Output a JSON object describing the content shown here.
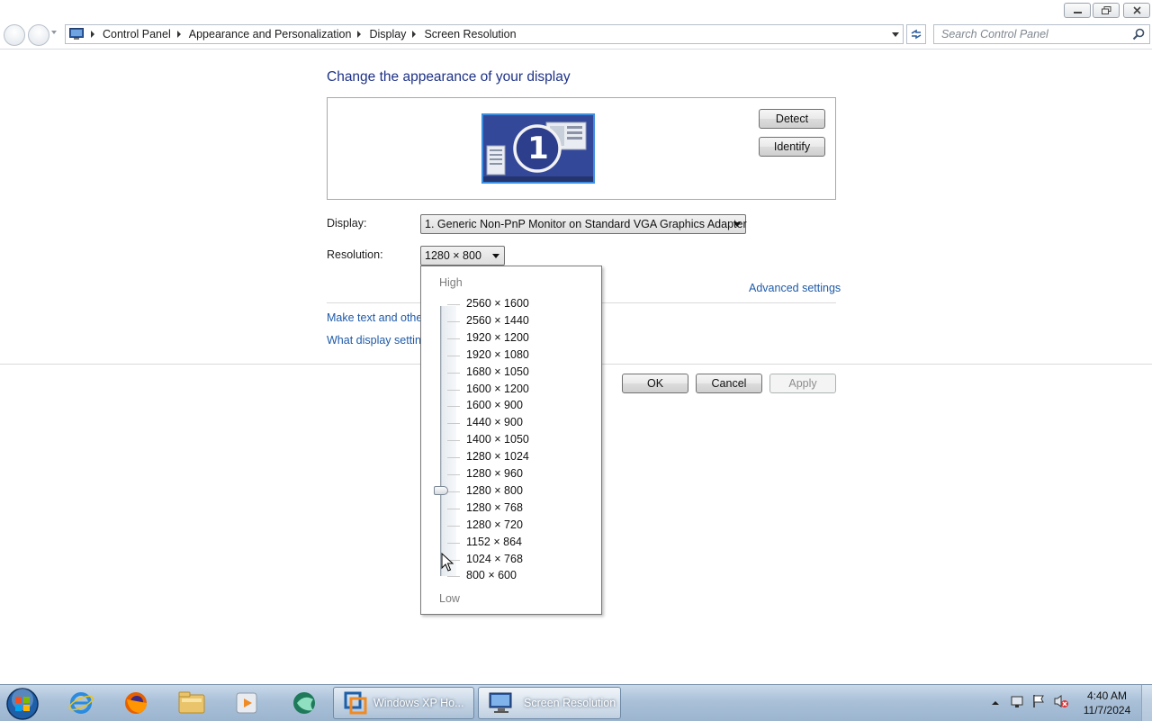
{
  "window": {
    "controls": {
      "minimize": "minimize",
      "restore": "restore",
      "close": "close"
    }
  },
  "address_bar": {
    "breadcrumbs": [
      "Control Panel",
      "Appearance and Personalization",
      "Display",
      "Screen Resolution"
    ],
    "search_placeholder": "Search Control Panel"
  },
  "main": {
    "heading": "Change the appearance of your display",
    "monitor_number": "1",
    "detect_button": "Detect",
    "identify_button": "Identify",
    "display_label": "Display:",
    "display_value": "1. Generic Non-PnP Monitor on Standard VGA Graphics Adapter",
    "resolution_label": "Resolution:",
    "resolution_value": "1280 × 800",
    "advanced_settings_link": "Advanced settings",
    "text_size_link": "Make text and other",
    "display_settings_link": "What display setting",
    "ok_button": "OK",
    "cancel_button": "Cancel",
    "apply_button": "Apply"
  },
  "resolution_dropdown": {
    "high_label": "High",
    "low_label": "Low",
    "options": [
      "2560 × 1600",
      "2560 × 1440",
      "1920 × 1200",
      "1920 × 1080",
      "1680 × 1050",
      "1600 × 1200",
      "1600 × 900",
      "1440 × 900",
      "1400 × 1050",
      "1280 × 1024",
      "1280 × 960",
      "1280 × 800",
      "1280 × 768",
      "1280 × 720",
      "1152 × 864",
      "1024 × 768",
      "800 × 600"
    ],
    "selected_index": 11
  },
  "taskbar": {
    "pinned": [
      "internet-explorer-icon",
      "firefox-icon",
      "file-explorer-icon",
      "media-player-icon",
      "app-icon"
    ],
    "tasks": [
      {
        "label": "Windows XP Ho...",
        "icon": "virtual-machine-icon"
      },
      {
        "label": "Screen Resolution",
        "icon": "display-icon"
      }
    ],
    "clock": {
      "time": "4:40 AM",
      "date": "11/7/2024"
    }
  }
}
